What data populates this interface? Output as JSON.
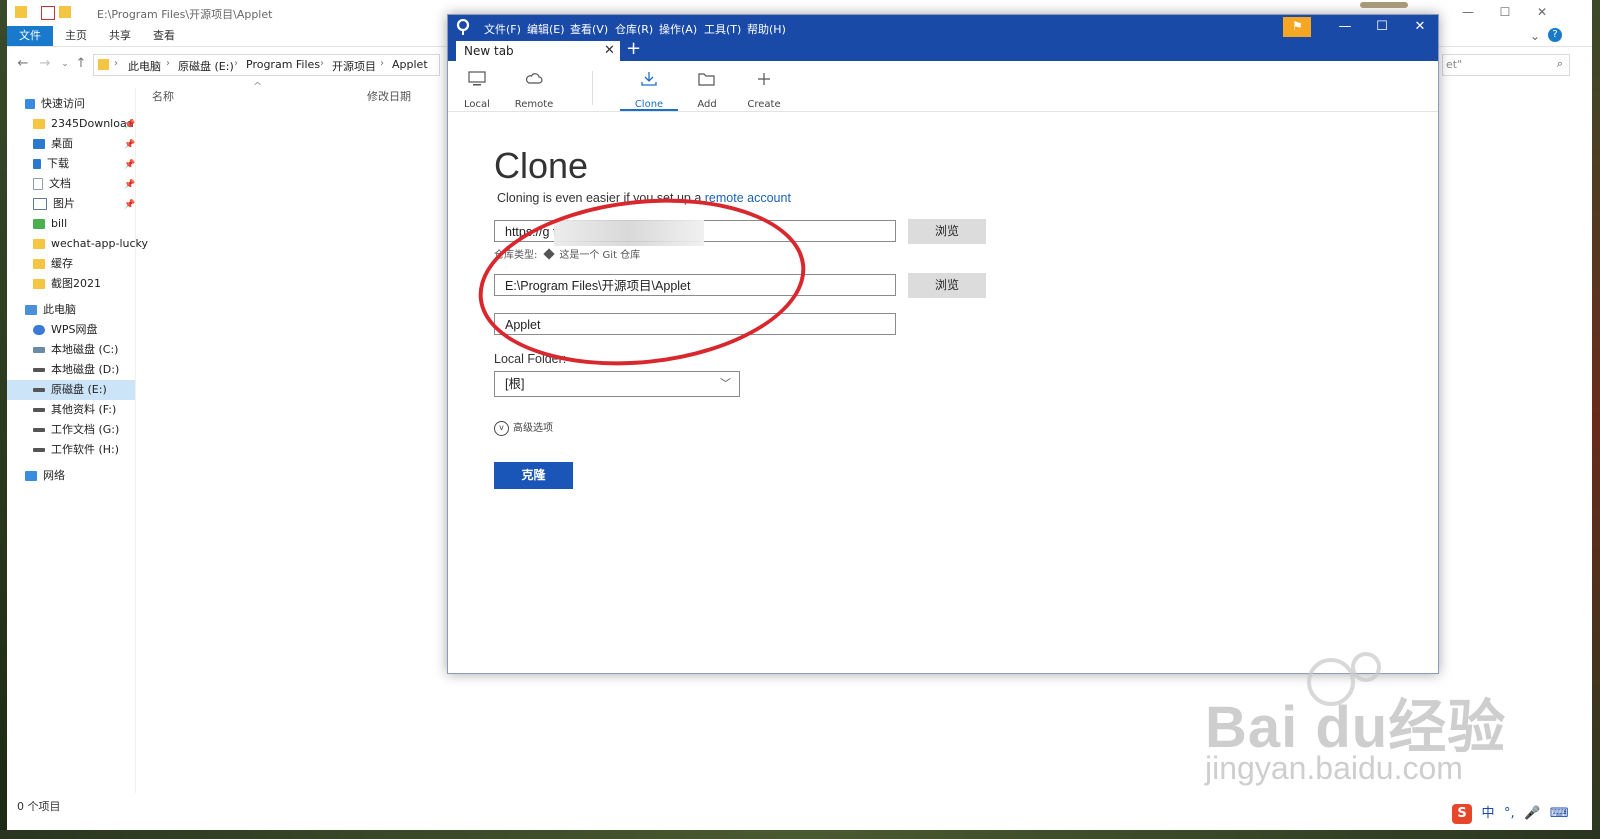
{
  "explorer": {
    "title_path": "E:\\Program Files\\开源项目\\Applet",
    "ribbon_tabs": [
      "文件",
      "主页",
      "共享",
      "查看"
    ],
    "breadcrumbs": [
      "此电脑",
      "原磁盘 (E:)",
      "Program Files",
      "开源项目",
      "Applet"
    ],
    "search_fragment": "et\"",
    "columns": {
      "name": "名称",
      "modified": "修改日期"
    },
    "nav": [
      {
        "label": "快速访问",
        "icon": "star-icon"
      },
      {
        "label": "2345Download",
        "icon": "folder-icon",
        "pinned": true
      },
      {
        "label": "桌面",
        "icon": "desktop-icon",
        "pinned": true
      },
      {
        "label": "下载",
        "icon": "download-icon",
        "pinned": true
      },
      {
        "label": "文档",
        "icon": "document-icon",
        "pinned": true
      },
      {
        "label": "图片",
        "icon": "pictures-icon",
        "pinned": true
      },
      {
        "label": "bill",
        "icon": "folder-icon"
      },
      {
        "label": "wechat-app-lucky",
        "icon": "folder-icon"
      },
      {
        "label": "缓存",
        "icon": "folder-icon"
      },
      {
        "label": "截图2021",
        "icon": "folder-icon"
      },
      {
        "label": "此电脑",
        "icon": "computer-icon"
      },
      {
        "label": "WPS网盘",
        "icon": "cloud-icon"
      },
      {
        "label": "本地磁盘 (C:)",
        "icon": "drive-icon"
      },
      {
        "label": "本地磁盘 (D:)",
        "icon": "drive-icon"
      },
      {
        "label": "原磁盘 (E:)",
        "icon": "drive-icon",
        "selected": true
      },
      {
        "label": "其他资料 (F:)",
        "icon": "drive-icon"
      },
      {
        "label": "工作文档 (G:)",
        "icon": "drive-icon"
      },
      {
        "label": "工作软件 (H:)",
        "icon": "drive-icon"
      },
      {
        "label": "网络",
        "icon": "network-icon"
      }
    ],
    "status": "0 个项目"
  },
  "sourcetree": {
    "menu": [
      "文件(F)",
      "编辑(E)",
      "查看(V)",
      "仓库(R)",
      "操作(A)",
      "工具(T)",
      "帮助(H)"
    ],
    "tab_label": "New tab",
    "toolbar": [
      {
        "label": "Local",
        "icon": "monitor-icon"
      },
      {
        "label": "Remote",
        "icon": "cloud-icon"
      },
      {
        "label": "Clone",
        "icon": "download-icon",
        "active": true
      },
      {
        "label": "Add",
        "icon": "folder-open-icon"
      },
      {
        "label": "Create",
        "icon": "plus-icon"
      }
    ],
    "heading": "Clone",
    "subtitle_prefix": "Cloning is even easier if you set up a ",
    "subtitle_link": "remote account",
    "source_url": "https://g                      t",
    "repo_type_label": "仓库类型:",
    "repo_type_value": "这是一个 Git 仓库",
    "dest_path": "E:\\Program Files\\开源项目\\Applet",
    "name": "Applet",
    "browse_label": "浏览",
    "local_folder_label": "Local Folder:",
    "local_folder_value": "[根]",
    "advanced_label": "高级选项",
    "clone_button": "克隆"
  },
  "colors": {
    "accent": "#1a4aa8",
    "highlight_circle": "#d8282e",
    "flag": "#f5a623"
  },
  "watermark": {
    "brand": "Bai  du经验",
    "url": "jingyan.baidu.com"
  },
  "tray": [
    "中",
    "°,",
    "🎤",
    "⌨"
  ]
}
